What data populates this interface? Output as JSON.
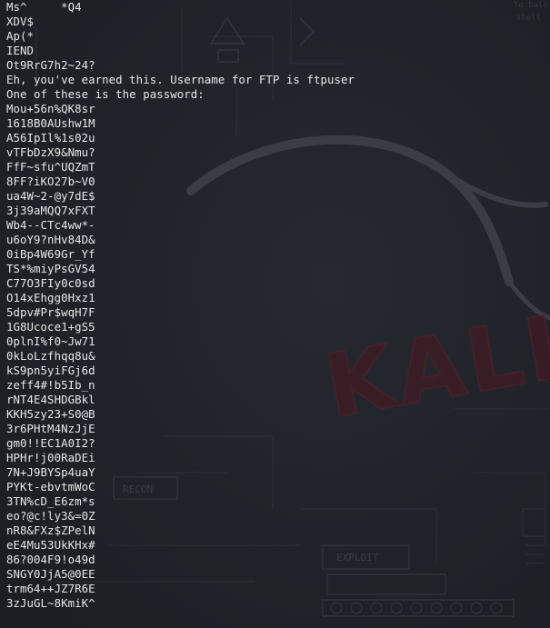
{
  "terminal": {
    "lines": [
      "Ms^     *Q4",
      "XDV$",
      "Ap(*",
      "IEND",
      "Ot9RrG7h2~24?",
      "Eh, you've earned this. Username for FTP is ftpuser",
      "One of these is the password:",
      "Mou+56n%QK8sr",
      "1618B0AUshw1M",
      "A56IpIl%1s02u",
      "vTFbDzX9&Nmu?",
      "FfF~sfu^UQZmT",
      "8FF?iKO27b~V0",
      "ua4W~2-@y7dE$",
      "3j39aMQQ7xFXT",
      "Wb4--CTc4ww*-",
      "u6oY9?nHv84D&",
      "0iBp4W69Gr_Yf",
      "TS*%miyPsGV54",
      "C77O3FIy0c0sd",
      "O14xEhgg0Hxz1",
      "5dpv#Pr$wqH7F",
      "1G8Ucoce1+gS5",
      "0plnI%f0~Jw71",
      "0kLoLzfhqq8u&",
      "kS9pn5yiFGj6d",
      "zeff4#!b5Ib_n",
      "rNT4E4SHDGBkl",
      "KKH5zy23+S0@B",
      "3r6PHtM4NzJjE",
      "gm0!!EC1A0I2?",
      "HPHr!j00RaDEi",
      "7N+J9BYSp4uaY",
      "PYKt-ebvtmWoC",
      "3TN%cD_E6zm*s",
      "eo?@c!ly3&=0Z",
      "nR8&FXz$ZPelN",
      "eE4Mu53UkKHx#",
      "86?004F9!o49d",
      "SNGY0JjA5@0EE",
      "trm64++JZ7R6E",
      "3zJuGL~8KmiK^"
    ]
  },
  "wallpaper": {
    "logo_text": "KALI",
    "labels": [
      "RECON",
      "EXPLOIT"
    ],
    "corner_text": [
      "To bale",
      "shell"
    ],
    "colors": {
      "background": "#1f2128",
      "ink": "#34363f",
      "ink_light": "#3c3e48",
      "text": "#e6e6e6"
    }
  }
}
